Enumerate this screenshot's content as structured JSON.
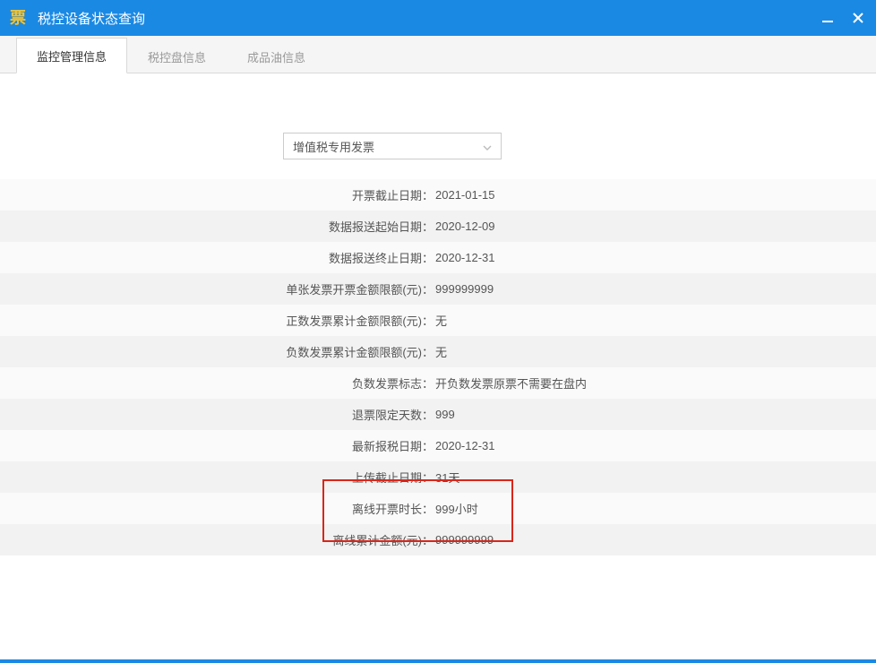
{
  "window": {
    "title": "税控设备状态查询",
    "icon_label": "票"
  },
  "tabs": [
    {
      "label": "监控管理信息",
      "active": true
    },
    {
      "label": "税控盘信息",
      "active": false
    },
    {
      "label": "成品油信息",
      "active": false
    }
  ],
  "dropdown": {
    "selected": "增值税专用发票"
  },
  "rows": [
    {
      "label": "开票截止日期：",
      "value": "2021-01-15"
    },
    {
      "label": "数据报送起始日期：",
      "value": "2020-12-09"
    },
    {
      "label": "数据报送终止日期：",
      "value": "2020-12-31"
    },
    {
      "label": "单张发票开票金额限额(元)：",
      "value": "999999999"
    },
    {
      "label": "正数发票累计金额限额(元)：",
      "value": "无"
    },
    {
      "label": "负数发票累计金额限额(元)：",
      "value": "无"
    },
    {
      "label": "负数发票标志：",
      "value": "开负数发票原票不需要在盘内"
    },
    {
      "label": "退票限定天数：",
      "value": "999"
    },
    {
      "label": "最新报税日期：",
      "value": "2020-12-31"
    },
    {
      "label": "上传截止日期：",
      "value": "31天"
    },
    {
      "label": "离线开票时长：",
      "value": "999小时"
    },
    {
      "label": "离线累计金额(元)：",
      "value": "999999999"
    }
  ]
}
